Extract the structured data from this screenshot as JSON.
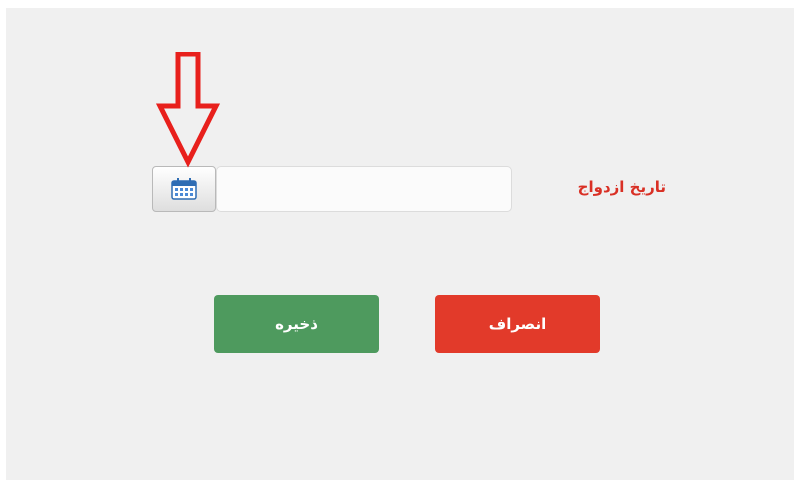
{
  "form": {
    "field_label": "تاریخ ازدواج",
    "date_value": "",
    "calendar_icon": "calendar-icon"
  },
  "annotation": {
    "arrow_icon": "down-arrow-icon",
    "color": "#e8201c"
  },
  "actions": {
    "save_label": "ذخیره",
    "cancel_label": "انصراف",
    "save_color": "#4e9a5e",
    "cancel_color": "#e23a2a"
  }
}
